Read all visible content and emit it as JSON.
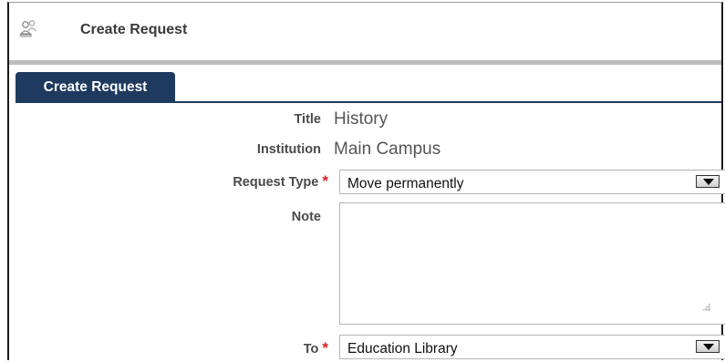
{
  "header": {
    "icon": "users-icon",
    "title": "Create Request"
  },
  "tab": {
    "label": "Create Request"
  },
  "form": {
    "title_label": "Title",
    "title_value": "History",
    "institution_label": "Institution",
    "institution_value": "Main Campus",
    "request_type_label": "Request Type",
    "request_type_value": "Move permanently",
    "note_label": "Note",
    "note_value": "",
    "to_label": "To",
    "to_value": "Education Library",
    "required_marker": "*"
  },
  "colors": {
    "tab_background": "#1f3a5f",
    "required": "#dd2222"
  }
}
